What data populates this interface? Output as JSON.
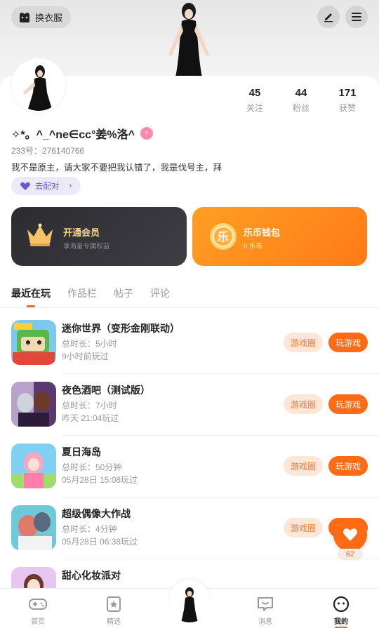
{
  "header": {
    "dress_label": "换衣服",
    "icons": [
      "hanger-icon",
      "edit-icon",
      "menu-icon"
    ]
  },
  "profile": {
    "stats": [
      {
        "value": "45",
        "label": "关注"
      },
      {
        "value": "44",
        "label": "粉丝"
      },
      {
        "value": "171",
        "label": "获赞"
      }
    ],
    "nickname": "✧*。^_^ne∈cc°姜%洛^",
    "id_line": "233号：276140766",
    "bio": "我不是原主，请大家不要把我认错了，我是伐号主，拜",
    "match_label": "去配对",
    "gender": "female"
  },
  "cards": {
    "vip": {
      "title": "开通会员",
      "subtitle": "享海量专属权益"
    },
    "wallet": {
      "title": "乐币钱包",
      "subtitle": "0 乐币",
      "coin_glyph": "乐"
    }
  },
  "tabs": [
    {
      "label": "最近在玩",
      "active": true
    },
    {
      "label": "作品栏",
      "active": false
    },
    {
      "label": "帖子",
      "active": false
    },
    {
      "label": "评论",
      "active": false
    }
  ],
  "games": [
    {
      "name": "迷你世界（变形金刚联动）",
      "duration": "总时长：5小时",
      "last_played": "9小时前玩过",
      "circle_label": "游戏圈",
      "play_label": "玩游戏"
    },
    {
      "name": "夜色酒吧（测试版）",
      "duration": "总时长：7小时",
      "last_played": "昨天 21:04玩过",
      "circle_label": "游戏圈",
      "play_label": "玩游戏"
    },
    {
      "name": "夏日海岛",
      "duration": "总时长：50分钟",
      "last_played": "05月28日 15:08玩过",
      "circle_label": "游戏圈",
      "play_label": "玩游戏"
    },
    {
      "name": "超级偶像大作战",
      "duration": "总时长：4分钟",
      "last_played": "05月28日 06:38玩过",
      "circle_label": "游戏圈",
      "play_label": "玩游戏"
    },
    {
      "name": "甜心化妆派对",
      "duration": "",
      "last_played": "",
      "circle_label": "",
      "play_label": ""
    }
  ],
  "floating": {
    "like_count": "62"
  },
  "bottom_nav": [
    {
      "label": "首页",
      "active": false
    },
    {
      "label": "精选",
      "active": false
    },
    {
      "label": "消息",
      "active": false
    },
    {
      "label": "我的",
      "active": true
    }
  ],
  "colors": {
    "accent": "#ff6a14",
    "wallet": "#ff8a1c",
    "vip_bg": "#2f2f34",
    "match_bg": "#ece9fb"
  }
}
